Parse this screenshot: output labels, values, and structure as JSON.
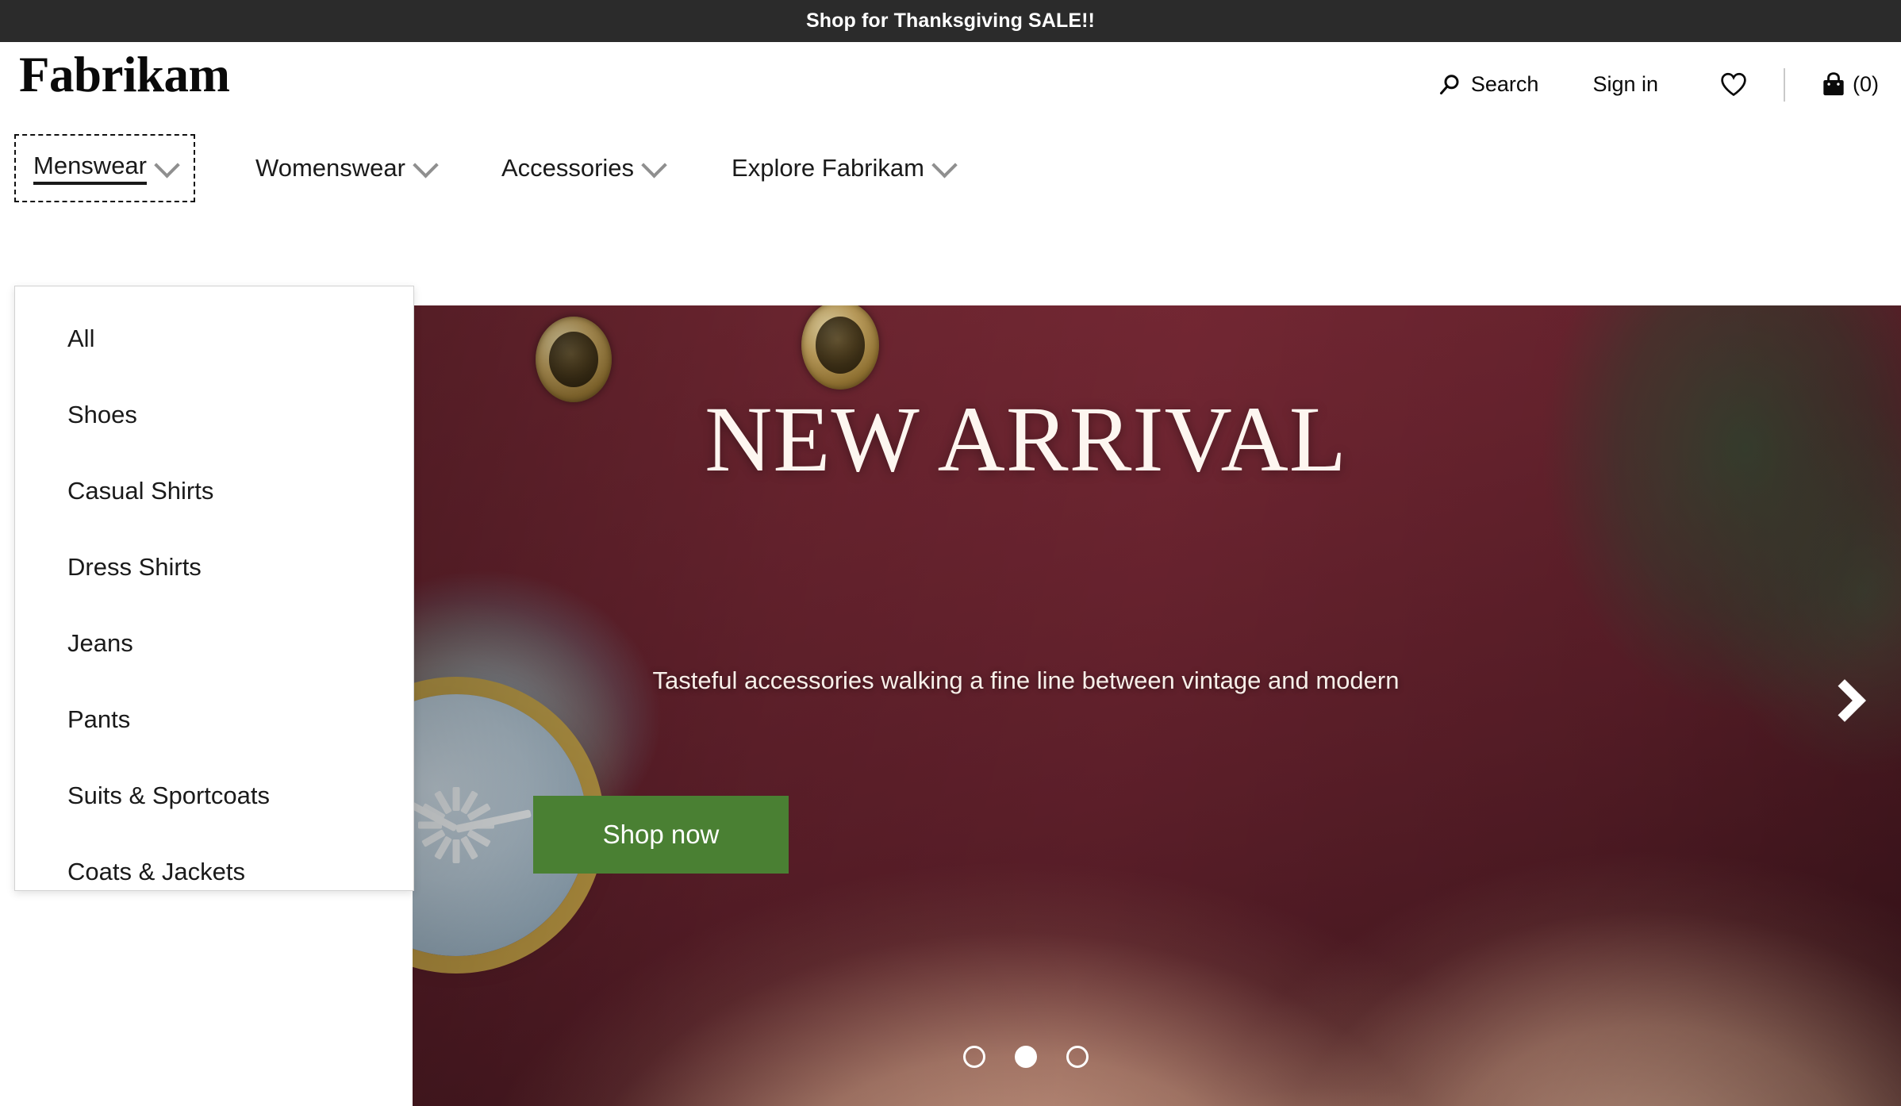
{
  "promo": {
    "text": "Shop for Thanksgiving SALE!!",
    "background": "#2b2b2b"
  },
  "header": {
    "logo": "Fabrikam",
    "search_label": "Search",
    "search_icon": "search-icon",
    "signin_label": "Sign in",
    "wishlist_icon": "heart-icon",
    "cart_icon": "shopping-bag-icon",
    "cart_count": "(0)"
  },
  "nav": {
    "items": [
      {
        "label": "Menswear",
        "icon": "chevron-down-icon",
        "focused": true
      },
      {
        "label": "Womenswear",
        "icon": "chevron-down-icon",
        "focused": false
      },
      {
        "label": "Accessories",
        "icon": "chevron-down-icon",
        "focused": false
      },
      {
        "label": "Explore Fabrikam",
        "icon": "chevron-down-icon",
        "focused": false
      }
    ]
  },
  "dropdown": {
    "open_for": "Menswear",
    "items": [
      {
        "label": "All"
      },
      {
        "label": "Shoes"
      },
      {
        "label": "Casual Shirts"
      },
      {
        "label": "Dress Shirts"
      },
      {
        "label": "Jeans"
      },
      {
        "label": "Pants"
      },
      {
        "label": "Suits & Sportcoats"
      },
      {
        "label": "Coats & Jackets"
      }
    ]
  },
  "hero": {
    "title": "NEW ARRIVAL",
    "subtitle": "Tasteful accessories walking a fine line between vintage and modern",
    "cta_label": "Shop now",
    "cta_color": "#4a8033",
    "next_icon": "chevron-right-icon",
    "slides": [
      {
        "active": false
      },
      {
        "active": true
      },
      {
        "active": false
      }
    ]
  }
}
